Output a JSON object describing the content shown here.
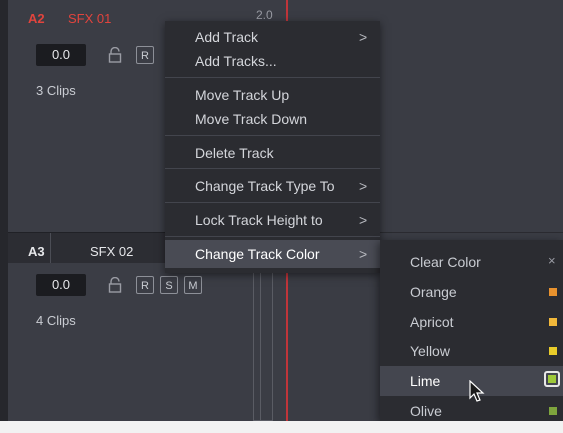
{
  "tracks": [
    {
      "id": "A2",
      "name": "SFX 01",
      "volume": "0.0",
      "clips": "3 Clips",
      "buttons": [
        "R"
      ]
    },
    {
      "id": "A3",
      "name": "SFX 02",
      "volume": "0.0",
      "clips": "4 Clips",
      "buttons": [
        "R",
        "S",
        "M"
      ]
    }
  ],
  "ruler_label": "2.0",
  "context_menu": {
    "items": [
      {
        "label": "Add Track",
        "has_submenu": true
      },
      {
        "label": "Add Tracks...",
        "has_submenu": false
      },
      {
        "label": "Move Track Up",
        "has_submenu": false
      },
      {
        "label": "Move Track Down",
        "has_submenu": false
      },
      {
        "label": "Delete Track",
        "has_submenu": false
      },
      {
        "label": "Change Track Type To",
        "has_submenu": true
      },
      {
        "label": "Lock Track Height to",
        "has_submenu": true
      },
      {
        "label": "Change Track Color",
        "has_submenu": true,
        "active": true
      }
    ],
    "arrow_glyph": ">"
  },
  "color_submenu": {
    "clear_glyph": "×",
    "items": [
      {
        "label": "Clear Color",
        "color": ""
      },
      {
        "label": "Orange",
        "color": "#e8922e"
      },
      {
        "label": "Apricot",
        "color": "#f1b83a"
      },
      {
        "label": "Yellow",
        "color": "#e9cc2a"
      },
      {
        "label": "Lime",
        "color": "#9fc93a",
        "selected": true
      },
      {
        "label": "Olive",
        "color": "#7ea43d"
      }
    ]
  },
  "colors": {
    "accent_red": "#e1443d",
    "playhead": "#c0353a",
    "menu_bg": "#2b2c31",
    "menu_highlight": "#494b54"
  },
  "icons": [
    "lock-icon",
    "submenu-arrow-icon",
    "clear-icon",
    "pointer-cursor-icon"
  ]
}
